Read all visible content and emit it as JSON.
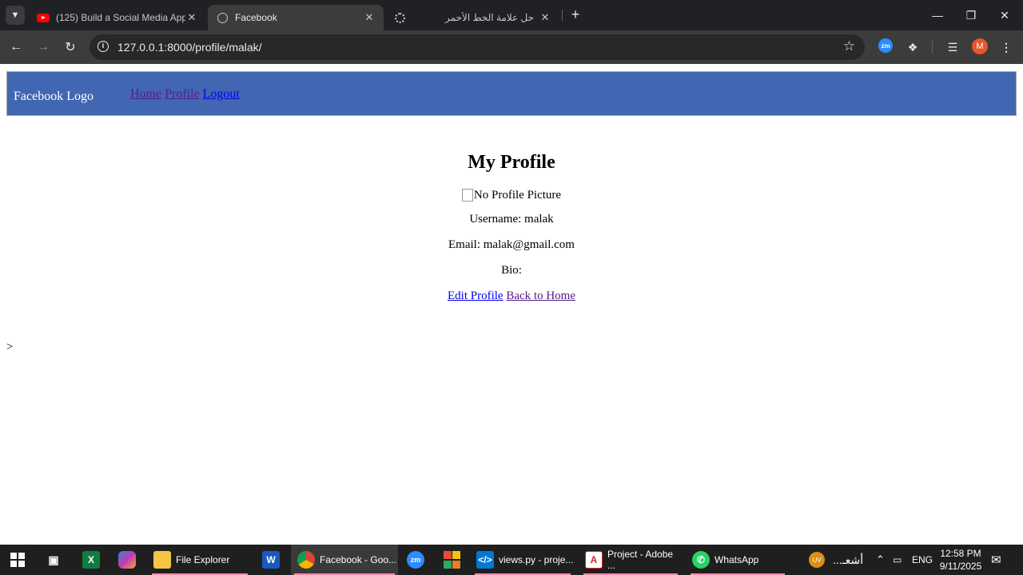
{
  "browser": {
    "tabs": [
      {
        "title": "(125) Build a Social Media App",
        "favicon": "youtube-icon",
        "active": false
      },
      {
        "title": "Facebook",
        "favicon": "globe-icon",
        "active": true
      },
      {
        "title": "حل علامة الخط الأحمر",
        "favicon": "chatgpt-icon",
        "active": false
      }
    ],
    "new_tab_label": "+",
    "url": "127.0.0.1:8000/profile/malak/",
    "toolbar_icons": [
      "zoom-extension-icon",
      "extensions-icon",
      "reading-list-icon",
      "profile-avatar-icon",
      "menu-icon"
    ],
    "profile_initial": "M",
    "zoom_ext_label": "zm"
  },
  "site": {
    "logo_alt": "Facebook Logo",
    "nav": {
      "home": "Home",
      "profile": "Profile",
      "logout": "Logout"
    },
    "header_color": "#4267b2"
  },
  "profile": {
    "heading": "My Profile",
    "picture_alt": "No Profile Picture",
    "username": "Username: malak",
    "email": "Email: malak@gmail.com",
    "bio": "Bio:",
    "edit_link": "Edit Profile",
    "home_link": "Back to Home",
    "stray_char": ">"
  },
  "taskbar": {
    "items": [
      {
        "label": "",
        "icon": "task-view-icon"
      },
      {
        "label": "",
        "icon": "excel-icon"
      },
      {
        "label": "",
        "icon": "copilot-icon"
      },
      {
        "label": "File Explorer",
        "icon": "file-explorer-icon"
      },
      {
        "label": "",
        "icon": "word-icon"
      },
      {
        "label": "Facebook - Goo...",
        "icon": "chrome-icon"
      },
      {
        "label": "",
        "icon": "zoom-icon"
      },
      {
        "label": "",
        "icon": "app-grid-icon"
      },
      {
        "label": "views.py - proje...",
        "icon": "vscode-icon"
      },
      {
        "label": "Project - Adobe ...",
        "icon": "acrobat-icon"
      },
      {
        "label": "WhatsApp",
        "icon": "whatsapp-icon"
      }
    ],
    "notification_text": "أشعـ...",
    "notification_badge": "UV",
    "language": "ENG",
    "time": "12:58 PM",
    "date": "9/11/2025"
  }
}
